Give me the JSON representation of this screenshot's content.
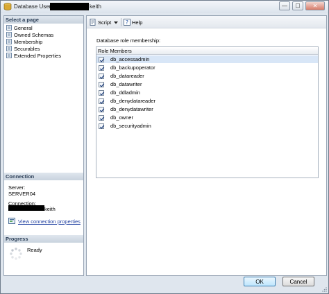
{
  "window": {
    "title_prefix": "Database User",
    "title_suffix": "keith",
    "minimize": "—",
    "maximize": "☐",
    "close": "✕"
  },
  "select_page": {
    "header": "Select a page",
    "items": [
      {
        "label": "General"
      },
      {
        "label": "Owned Schemas"
      },
      {
        "label": "Membership"
      },
      {
        "label": "Securables"
      },
      {
        "label": "Extended Properties"
      }
    ]
  },
  "connection": {
    "header": "Connection",
    "server_label": "Server:",
    "server_value": "SERVER04",
    "connection_label": "Connection:",
    "connection_suffix": "keith",
    "view_properties": "View connection properties"
  },
  "progress": {
    "header": "Progress",
    "status": "Ready"
  },
  "toolbar": {
    "script_label": "Script",
    "help_label": "Help"
  },
  "membership": {
    "group_label": "Database role membership:",
    "column_header": "Role Members",
    "roles": [
      {
        "name": "db_accessadmin",
        "checked": true
      },
      {
        "name": "db_backupoperator",
        "checked": true
      },
      {
        "name": "db_datareader",
        "checked": true
      },
      {
        "name": "db_datawriter",
        "checked": true
      },
      {
        "name": "db_ddladmin",
        "checked": true
      },
      {
        "name": "db_denydatareader",
        "checked": true
      },
      {
        "name": "db_denydatawriter",
        "checked": true
      },
      {
        "name": "db_owner",
        "checked": true
      },
      {
        "name": "db_securityadmin",
        "checked": true
      }
    ]
  },
  "footer": {
    "ok": "OK",
    "cancel": "Cancel"
  }
}
